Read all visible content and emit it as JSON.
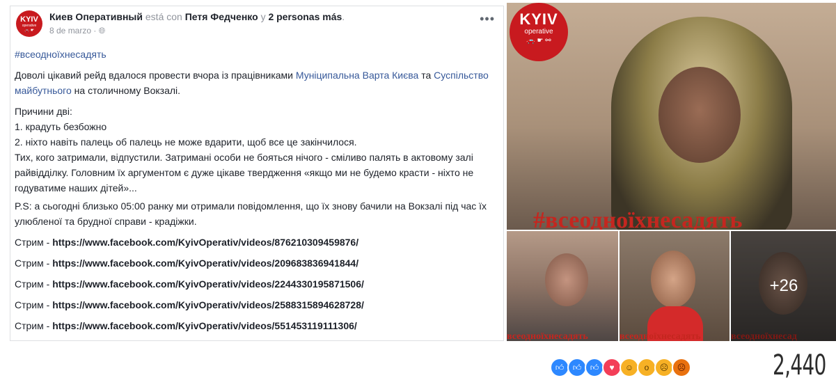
{
  "post": {
    "page_name": "Киев Оперативный",
    "with_text": "está con",
    "tagged_person": "Петя Федченко",
    "and_text": "y",
    "others": "2 personas más",
    "date": "8 de marzo",
    "audience_icon": "globe-icon",
    "menu_icon": "more-dots-icon",
    "avatar": {
      "line1": "KYIV",
      "line2": "operative"
    },
    "hashtag": "#всеоднοїхнесадять",
    "paragraph1_before": "Доволі цікавий рейд вдалося провести вчора із працівниками ",
    "link1": "Муніципальна Варта Києва",
    "paragraph1_mid": " та ",
    "link2": "Суспільство майбутнього",
    "paragraph1_after": " на столичному Вокзалі.",
    "lines": [
      "Причини дві:",
      "1. крадуть безбожно",
      "2. ніхто навіть палець об палець не може вдарити, щоб все це закінчилося.",
      "Тих, кого затримали, відпустили. Затримані особи не бояться нічого - сміливо палять в актовому залі райвідділку. Головним їх аргументом є дуже цікаве твердження «якщо ми не будемо красти - ніхто не годуватиме наших дітей»..."
    ],
    "ps": "P.S: а сьогодні близько 05:00 ранку ми отримали повідомлення, що їх знову бачили на Вокзалі під час їх улюбленої та брудної справи - крадіжки.",
    "stream_label": "Стрим - ",
    "streams": [
      "https://www.facebook.com/KyivOperativ/videos/876210309459876/",
      "https://www.facebook.com/KyivOperativ/videos/209683836941844/",
      "https://www.facebook.com/KyivOperativ/videos/2244330195871506/",
      "https://www.facebook.com/KyivOperativ/videos/2588315894628728/",
      "https://www.facebook.com/KyivOperativ/videos/551453119111306/"
    ]
  },
  "photos": {
    "logo_line1": "KYIV",
    "logo_line2": "operative",
    "big_tag": "#всеоднοїхнесадять",
    "thumb1_tag": "всеоднοїхнесадять",
    "thumb2_tag": "всеоднοїхнесадять",
    "thumb3_tag": "всеоднοїхнесад",
    "more_count": "+26"
  },
  "reactions": {
    "icons": [
      "like-icon",
      "like-icon",
      "like-icon",
      "love-icon",
      "haha-icon",
      "wow-icon",
      "sad-icon",
      "angry-icon"
    ],
    "colors": [
      "#2d88ff",
      "#2d88ff",
      "#2d88ff",
      "#f33e58",
      "#f7b125",
      "#f7b125",
      "#f7b125",
      "#e9710f"
    ],
    "count": "2,440"
  }
}
